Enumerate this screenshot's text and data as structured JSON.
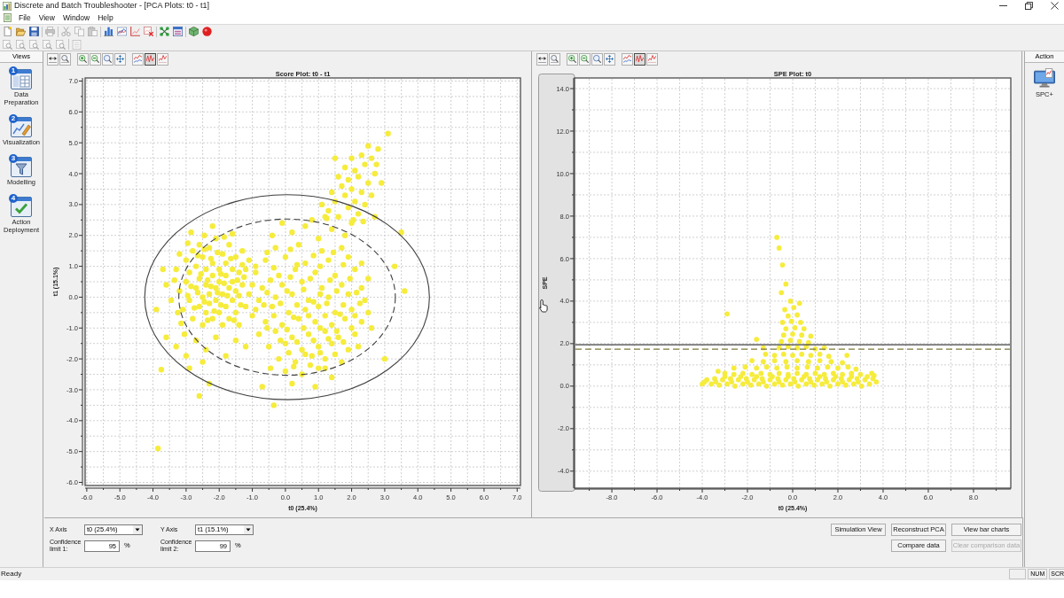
{
  "window": {
    "title": "Discrete and Batch Troubleshooter - [PCA Plots: t0 - t1]"
  },
  "menu": [
    "File",
    "View",
    "Window",
    "Help"
  ],
  "toolbars": [
    [
      [
        {
          "kind": "new",
          "disabled": false
        },
        {
          "kind": "open",
          "disabled": false
        },
        {
          "kind": "save",
          "disabled": false
        }
      ],
      [
        {
          "kind": "print",
          "disabled": true
        }
      ],
      [
        {
          "kind": "cut",
          "disabled": true
        },
        {
          "kind": "copy",
          "disabled": true
        },
        {
          "kind": "paste",
          "disabled": true
        }
      ],
      [
        {
          "kind": "bars",
          "disabled": false
        },
        {
          "kind": "lines",
          "disabled": false
        },
        {
          "kind": "axes",
          "disabled": false
        },
        {
          "kind": "delete",
          "disabled": false
        }
      ],
      [
        {
          "kind": "network",
          "disabled": false
        },
        {
          "kind": "window",
          "disabled": false
        }
      ],
      [
        {
          "kind": "cube",
          "disabled": false
        },
        {
          "kind": "record",
          "disabled": false
        }
      ]
    ],
    [
      [
        {
          "kind": "zoom-page",
          "disabled": true
        },
        {
          "kind": "zoom-page",
          "disabled": true
        },
        {
          "kind": "zoom-page",
          "disabled": true
        },
        {
          "kind": "zoom-page",
          "disabled": true
        },
        {
          "kind": "zoom-page",
          "disabled": true
        }
      ],
      [
        {
          "kind": "page",
          "disabled": true
        }
      ]
    ]
  ],
  "views": {
    "title": "Views",
    "items": [
      {
        "step": "1",
        "label": "Data Preparation",
        "kind": "data"
      },
      {
        "step": "2",
        "label": "Visualization",
        "kind": "chart"
      },
      {
        "step": "3",
        "label": "Modelling",
        "kind": "filter"
      },
      {
        "step": "4",
        "label": "Action Deployment",
        "kind": "check"
      }
    ]
  },
  "plots": [
    {
      "hovered": false,
      "toolbar": [
        [
          {
            "kind": "fit",
            "pressed": false
          },
          {
            "kind": "zoom-box",
            "pressed": false
          }
        ],
        [
          {
            "kind": "zoom-in",
            "pressed": false
          },
          {
            "kind": "zoom-out",
            "pressed": false
          },
          {
            "kind": "zoom",
            "pressed": false
          },
          {
            "kind": "pan",
            "pressed": false
          }
        ],
        [
          {
            "kind": "lines",
            "pressed": false
          },
          {
            "kind": "zigzag",
            "pressed": true
          },
          {
            "kind": "trend",
            "pressed": false
          }
        ]
      ],
      "limit_ellipses": [
        {
          "dashed": false
        },
        {
          "dashed": true
        }
      ],
      "chart_data": {
        "type": "scatter",
        "title": "Score Plot: t0 - t1",
        "xlabel": "t0 (25.4%)",
        "ylabel": "t1 (15.1%)",
        "grid": true,
        "xlim": [
          -6.05,
          7.1
        ],
        "ylim": [
          -6.1,
          7.1
        ],
        "xticks": [
          {
            "value": -6,
            "label": "-6.0"
          },
          {
            "value": -5,
            "label": "-5.0"
          },
          {
            "value": -4,
            "label": "-4.0"
          },
          {
            "value": -3,
            "label": "-3.0"
          },
          {
            "value": -2,
            "label": "-2.0"
          },
          {
            "value": -1,
            "label": "-1.0"
          },
          {
            "value": 0,
            "label": "0.0"
          },
          {
            "value": 1,
            "label": "1.0"
          },
          {
            "value": 2,
            "label": "2.0"
          },
          {
            "value": 3,
            "label": "3.0"
          },
          {
            "value": 4,
            "label": "4.0"
          },
          {
            "value": 5,
            "label": "5.0"
          },
          {
            "value": 6,
            "label": "6.0"
          },
          {
            "value": 7,
            "label": "7.0"
          }
        ],
        "yticks": [
          {
            "value": -6,
            "label": "-6.0"
          },
          {
            "value": -5,
            "label": "-5.0"
          },
          {
            "value": -4,
            "label": "-4.0"
          },
          {
            "value": -3,
            "label": "-3.0"
          },
          {
            "value": -2,
            "label": "-2.0"
          },
          {
            "value": -1,
            "label": "-1.0"
          },
          {
            "value": 0,
            "label": "0.0"
          },
          {
            "value": 1,
            "label": "1.0"
          },
          {
            "value": 2,
            "label": "2.0"
          },
          {
            "value": 3,
            "label": "3.0"
          },
          {
            "value": 4,
            "label": "4.0"
          },
          {
            "value": 5,
            "label": "5.0"
          },
          {
            "value": 6,
            "label": "6.0"
          },
          {
            "value": 7,
            "label": "7.0"
          }
        ],
        "x": [
          -3.3,
          -3.2,
          -3.1,
          -3.0,
          -3.0,
          -2.9,
          -2.9,
          -2.8,
          -2.8,
          -2.7,
          -2.7,
          -2.6,
          -2.6,
          -2.6,
          -2.5,
          -2.5,
          -2.5,
          -2.4,
          -2.4,
          -2.4,
          -2.3,
          -2.3,
          -2.3,
          -2.2,
          -2.2,
          -2.2,
          -2.1,
          -2.1,
          -2.1,
          -2.0,
          -2.0,
          -2.0,
          -1.9,
          -1.9,
          -1.9,
          -1.8,
          -1.8,
          -1.8,
          -1.7,
          -1.7,
          -1.7,
          -1.6,
          -1.6,
          -1.6,
          -1.5,
          -1.5,
          -1.5,
          -1.4,
          -1.4,
          -1.3,
          -1.3,
          -1.2,
          -1.2,
          -1.1,
          -1.1,
          -1.0,
          -3.35,
          -3.15,
          -2.95,
          -2.75,
          -2.65,
          -2.55,
          -2.45,
          -2.35,
          -2.25,
          -2.15,
          -2.05,
          -1.95,
          -1.85,
          -1.75,
          -1.65,
          -1.55,
          -1.45,
          -1.35,
          -1.25,
          -3.45,
          -3.05,
          -2.85,
          -2.2,
          -3.6,
          -1.0,
          -0.9,
          -3.2,
          -2.95,
          -2.45,
          -1.6,
          -3.25,
          -2.85,
          -2.35,
          -1.95,
          -1.4,
          -2.65,
          -2.25,
          -1.85,
          -2.05,
          -2.45,
          -1.3,
          -3.3,
          -3.0,
          -2.7,
          -2.4,
          -2.1,
          -1.8,
          -1.5,
          -2.9,
          -2.5,
          -1.2,
          -3.85,
          -3.75,
          -3.9,
          -2.6,
          -2.3,
          -0.35,
          -0.7,
          -3.7,
          3.0,
          3.3,
          3.6,
          3.5,
          -3.6,
          -0.3,
          0.4,
          1.1,
          1.7,
          -0.6,
          0.0,
          0.6,
          1.3,
          1.9,
          2.3,
          -0.9,
          -0.2,
          0.3,
          0.9,
          1.5,
          2.1,
          2.5,
          -0.7,
          -0.1,
          0.5,
          1.1,
          1.7,
          2.3,
          -0.8,
          -0.3,
          0.2,
          0.7,
          1.3,
          1.9,
          2.4,
          -0.9,
          -0.4,
          0.1,
          0.6,
          1.0,
          1.5,
          2.0,
          2.5,
          -0.6,
          -0.1,
          0.4,
          0.9,
          1.4,
          1.8,
          2.3,
          -0.8,
          -0.3,
          0.2,
          0.7,
          1.2,
          1.6,
          2.1,
          -0.5,
          0.0,
          0.5,
          1.0,
          1.4,
          1.9,
          -0.2,
          0.3,
          0.8,
          1.2,
          1.7,
          0.0,
          0.5,
          1.0,
          1.4,
          0.2,
          0.9,
          -0.55,
          0.15,
          0.85,
          1.45,
          -0.35,
          0.35,
          1.05,
          1.75,
          -0.45,
          0.15,
          0.75,
          1.35,
          1.95,
          -0.55,
          0.05,
          0.55,
          1.05,
          1.55,
          2.15,
          -0.65,
          -0.15,
          0.35,
          0.85,
          1.25,
          1.75,
          2.25,
          -0.35,
          0.25,
          0.7,
          1.2,
          1.65,
          2.1,
          -0.55,
          0.05,
          0.55,
          1.05,
          1.55,
          2.0,
          -0.15,
          0.35,
          0.85,
          1.3,
          1.75,
          0.1,
          0.6,
          1.05,
          1.5,
          0.25,
          0.75,
          1.2,
          -0.45,
          2.2,
          2.6,
          -0.4,
          0.2,
          0.6,
          1.0,
          1.4,
          0.8,
          1.2,
          -0.1,
          1.8,
          2.0,
          1.3,
          1.6,
          1.9,
          2.2,
          1.5,
          1.8,
          2.1,
          2.4,
          1.4,
          1.7,
          2.0,
          2.3,
          2.6,
          1.6,
          1.9,
          2.2,
          2.5,
          1.8,
          2.1,
          2.4,
          2.7,
          2.0,
          2.3,
          2.6,
          2.5,
          2.8,
          3.1,
          2.9,
          1.1,
          2.7,
          1.5,
          2.75,
          1.25,
          2.05,
          2.35
        ],
        "series": [
          {
            "color": "#f6ec3c",
            "values": [
              0.9,
              0.2,
              -0.4,
              1.2,
              0.5,
              -0.1,
              0.8,
              1.5,
              -0.7,
              0.3,
              1.0,
              -0.3,
              0.6,
              1.7,
              0.0,
              1.3,
              -0.9,
              0.4,
              0.9,
              -0.5,
              1.6,
              0.1,
              -0.2,
              0.7,
              1.1,
              -0.7,
              0.3,
              1.9,
              -0.1,
              0.9,
              0.5,
              -0.5,
              1.4,
              0.1,
              -0.9,
              0.7,
              -0.3,
              1.1,
              0.3,
              -0.7,
              1.7,
              0.9,
              -0.1,
              0.5,
              1.3,
              -0.5,
              0.2,
              0.8,
              -0.9,
              0.4,
              1.5,
              -0.3,
              0.9,
              0.1,
              1.2,
              -0.6,
              0.55,
              -0.85,
              0.05,
              -0.35,
              1.35,
              0.75,
              -0.15,
              0.55,
              1.25,
              -0.45,
              0.15,
              0.75,
              1.95,
              0.05,
              1.25,
              -0.75,
              0.55,
              -0.25,
              0.65,
              -0.1,
              -1.2,
              2.1,
              2.3,
              0.4,
              0.4,
              1.0,
              1.4,
              1.75,
              2.0,
              2.05,
              -0.5,
              0.35,
              -0.75,
              -0.25,
              0.05,
              0.15,
              0.35,
              0.45,
              1.45,
              1.55,
              1.05,
              -1.6,
              -1.9,
              -1.4,
              -1.7,
              -1.3,
              -1.9,
              -1.4,
              -2.3,
              -2.1,
              -1.6,
              -4.9,
              -2.35,
              -0.4,
              -3.2,
              -2.8,
              -3.5,
              -2.9,
              0.9,
              -2.0,
              1.0,
              0.2,
              2.1,
              -1.3,
              1.6,
              1.7,
              1.5,
              1.6,
              1.2,
              1.3,
              1.1,
              1.2,
              1.3,
              1.1,
              0.8,
              0.7,
              0.9,
              0.8,
              0.7,
              0.9,
              0.6,
              0.3,
              0.4,
              0.5,
              0.3,
              0.4,
              0.3,
              -0.1,
              0.0,
              0.1,
              -0.1,
              0.0,
              0.1,
              -0.1,
              -0.4,
              -0.3,
              -0.5,
              -0.4,
              -0.3,
              -0.5,
              -0.4,
              -0.5,
              -0.8,
              -0.9,
              -0.7,
              -0.8,
              -0.9,
              -0.7,
              -0.8,
              -1.2,
              -1.1,
              -1.3,
              -1.2,
              -1.1,
              -1.3,
              -1.2,
              -1.6,
              -1.5,
              -1.7,
              -1.6,
              -1.5,
              -1.7,
              -2.0,
              -2.1,
              -1.9,
              -2.0,
              -2.1,
              -2.4,
              -2.5,
              -2.3,
              -2.6,
              -2.8,
              -2.9,
              1.45,
              1.55,
              1.35,
              1.45,
              0.95,
              1.05,
              1.0,
              1.05,
              0.55,
              0.65,
              0.6,
              0.55,
              0.6,
              0.15,
              0.2,
              0.25,
              0.1,
              0.2,
              0.15,
              -0.25,
              -0.2,
              -0.25,
              -0.15,
              -0.2,
              -0.25,
              -0.2,
              -0.6,
              -0.65,
              -0.6,
              -0.6,
              -0.55,
              -0.6,
              -1.0,
              -1.05,
              -1.0,
              -1.0,
              -1.1,
              -1.0,
              -1.4,
              -1.45,
              -1.4,
              -1.35,
              -1.45,
              -1.8,
              -1.85,
              -1.8,
              -1.85,
              -2.25,
              -2.2,
              -2.3,
              -2.3,
              -1.6,
              -1.0,
              2.0,
              2.1,
              2.3,
              1.9,
              2.2,
              2.5,
              2.6,
              2.4,
              2.0,
              2.4,
              2.8,
              2.6,
              2.9,
              2.7,
              3.1,
              3.3,
              3.1,
              3.0,
              3.4,
              3.6,
              3.5,
              3.4,
              3.3,
              3.9,
              3.8,
              3.9,
              3.7,
              4.2,
              4.1,
              4.3,
              4.0,
              4.5,
              4.6,
              4.5,
              4.9,
              4.8,
              5.3,
              3.7,
              3.0,
              2.6,
              4.5,
              4.3,
              2.55,
              2.5,
              2.45
            ]
          }
        ]
      }
    },
    {
      "hovered": true,
      "toolbar": [
        [
          {
            "kind": "fit",
            "pressed": false
          },
          {
            "kind": "zoom-box",
            "pressed": false
          }
        ],
        [
          {
            "kind": "zoom-in",
            "pressed": false
          },
          {
            "kind": "zoom-out",
            "pressed": false
          },
          {
            "kind": "zoom",
            "pressed": false
          },
          {
            "kind": "pan",
            "pressed": false
          }
        ],
        [
          {
            "kind": "lines",
            "pressed": false
          },
          {
            "kind": "zigzag",
            "pressed": true
          },
          {
            "kind": "trend",
            "pressed": false
          }
        ]
      ],
      "chart_data": {
        "type": "scatter",
        "title": "SPE Plot: t0",
        "xlabel": "t0 (25.4%)",
        "ylabel": "SPE",
        "grid": true,
        "xlim": [
          -9.65,
          9.65
        ],
        "ylim": [
          -4.8,
          14.5
        ],
        "xticks": [
          {
            "value": -8,
            "label": "-8.0"
          },
          {
            "value": -6,
            "label": "-6.0"
          },
          {
            "value": -4,
            "label": "-4.0"
          },
          {
            "value": -2,
            "label": "-2.0"
          },
          {
            "value": 0,
            "label": "0.0"
          },
          {
            "value": 2,
            "label": "2.0"
          },
          {
            "value": 4,
            "label": "4.0"
          },
          {
            "value": 6,
            "label": "6.0"
          },
          {
            "value": 8,
            "label": "8.0"
          }
        ],
        "yticks": [
          {
            "value": -4,
            "label": "-4.0"
          },
          {
            "value": -2,
            "label": "-2.0"
          },
          {
            "value": 0,
            "label": "0.0"
          },
          {
            "value": 2,
            "label": "2.0"
          },
          {
            "value": 4,
            "label": "4.0"
          },
          {
            "value": 6,
            "label": "6.0"
          },
          {
            "value": 8,
            "label": "8.0"
          },
          {
            "value": 10,
            "label": "10.0"
          },
          {
            "value": 12,
            "label": "12.0"
          },
          {
            "value": 14,
            "label": "14.0"
          }
        ],
        "x": [
          -3.6,
          -3.25,
          -2.9,
          -2.55,
          -2.2,
          -1.85,
          -1.5,
          -1.15,
          -0.8,
          -0.45,
          -0.1,
          0.25,
          0.6,
          0.95,
          1.3,
          1.65,
          2.0,
          2.35,
          2.7,
          3.05,
          3.4,
          -3.45,
          -3.1,
          -2.75,
          -2.4,
          -2.05,
          -1.7,
          -1.35,
          -1.0,
          -0.65,
          -0.3,
          0.05,
          0.4,
          0.75,
          1.1,
          1.45,
          1.8,
          2.15,
          2.5,
          2.85,
          3.2,
          3.55,
          -3.4,
          -2.7,
          -2.0,
          -1.3,
          -0.6,
          0.1,
          0.8,
          1.5,
          2.2,
          2.9,
          -3.0,
          -2.3,
          -1.6,
          -0.9,
          -0.2,
          0.5,
          1.2,
          1.9,
          2.6,
          3.3,
          -3.0,
          -2.6,
          -2.2,
          -1.8,
          -1.4,
          -1.0,
          -0.6,
          -0.2,
          0.2,
          0.6,
          1.0,
          1.4,
          1.8,
          2.2,
          2.6,
          3.0,
          -2.6,
          -2.1,
          -1.6,
          -1.15,
          -0.7,
          -0.25,
          0.2,
          0.65,
          1.1,
          1.55,
          2.0,
          2.45,
          2.8,
          -1.8,
          -1.3,
          -0.8,
          -0.3,
          0.2,
          0.7,
          1.2,
          1.7,
          2.2,
          -1.2,
          -0.8,
          -0.4,
          0.0,
          0.4,
          0.8,
          1.2,
          1.6,
          -0.6,
          -0.2,
          0.2,
          0.6,
          1.0,
          -0.5,
          -0.1,
          0.3,
          0.7,
          -0.4,
          0.0,
          0.4,
          0.8,
          -0.3,
          0.1,
          0.5,
          -0.45,
          -0.05,
          0.35,
          -0.2,
          0.2,
          -0.35,
          0.05,
          -0.1,
          0.3,
          -0.5,
          -0.3,
          -0.45,
          -0.6,
          -0.7,
          -2.9,
          -1.6,
          1.4,
          -3.9,
          3.6,
          -3.3,
          2.4,
          -1.3,
          -4.0,
          -3.8,
          3.7,
          3.5
        ],
        "series": [
          {
            "color": "#f6ec3c",
            "values": [
              0.1,
              0.05,
              0.1,
              0.0,
              0.1,
              0.05,
              0.1,
              0.0,
              0.1,
              0.05,
              0.1,
              0.0,
              0.1,
              0.05,
              0.1,
              0.0,
              0.1,
              0.05,
              0.1,
              0.0,
              0.1,
              0.35,
              0.3,
              0.35,
              0.3,
              0.35,
              0.3,
              0.35,
              0.3,
              0.35,
              0.3,
              0.35,
              0.3,
              0.35,
              0.3,
              0.35,
              0.3,
              0.35,
              0.3,
              0.35,
              0.3,
              0.35,
              0.2,
              0.2,
              0.2,
              0.2,
              0.2,
              0.2,
              0.2,
              0.2,
              0.2,
              0.2,
              0.45,
              0.45,
              0.45,
              0.45,
              0.45,
              0.45,
              0.45,
              0.45,
              0.45,
              0.45,
              0.6,
              0.55,
              0.6,
              0.55,
              0.6,
              0.55,
              0.6,
              0.55,
              0.6,
              0.55,
              0.6,
              0.55,
              0.6,
              0.55,
              0.6,
              0.55,
              0.85,
              0.9,
              0.85,
              0.9,
              0.85,
              0.9,
              0.85,
              0.9,
              0.85,
              0.9,
              0.85,
              0.9,
              0.8,
              1.2,
              1.15,
              1.2,
              1.15,
              1.2,
              1.15,
              1.2,
              1.15,
              1.1,
              1.5,
              1.45,
              1.5,
              1.45,
              1.5,
              1.45,
              1.5,
              1.4,
              1.8,
              1.85,
              1.8,
              1.85,
              1.75,
              2.1,
              2.15,
              2.1,
              2.05,
              2.4,
              2.45,
              2.4,
              2.35,
              2.7,
              2.75,
              2.7,
              3.0,
              3.05,
              3.0,
              3.3,
              3.35,
              3.6,
              3.7,
              4.0,
              3.9,
              4.4,
              4.8,
              5.7,
              6.5,
              7.0,
              3.4,
              2.2,
              1.8,
              0.2,
              0.5,
              0.7,
              1.45,
              1.8,
              0.1,
              0.3,
              0.2,
              0.6
            ]
          }
        ],
        "ref_lines": [
          {
            "axis": "y",
            "value": 1.95,
            "color": "#404040"
          },
          {
            "axis": "y",
            "value": 1.74,
            "color": "#7d7a3a"
          }
        ]
      }
    }
  ],
  "controls": {
    "fields": [
      [
        {
          "kind": "select",
          "label": "X Axis",
          "value": "t0 (25.4%)"
        },
        {
          "kind": "select",
          "label": "Y Axis",
          "value": "t1 (15.1%)"
        }
      ],
      [
        {
          "kind": "input",
          "label": "Confidence limit 1:",
          "value": "95",
          "unit": "%"
        },
        {
          "kind": "input",
          "label": "Confidence limit 2:",
          "value": "99",
          "unit": "%"
        }
      ]
    ],
    "button_rows": [
      [
        {
          "label": "Simulation View",
          "disabled": false
        },
        {
          "label": "Reconstruct PCA",
          "disabled": false
        },
        {
          "label": "View bar charts",
          "disabled": false
        }
      ],
      [
        {
          "label": "Compare data",
          "disabled": false
        },
        {
          "label": "Clear comparison data",
          "disabled": true
        }
      ]
    ]
  },
  "action": {
    "title": "Action",
    "items": [
      {
        "label": "SPC+",
        "kind": "monitor"
      }
    ]
  },
  "status_bar": {
    "text": "Ready",
    "indicators": [
      "NUM",
      "SCR"
    ]
  }
}
